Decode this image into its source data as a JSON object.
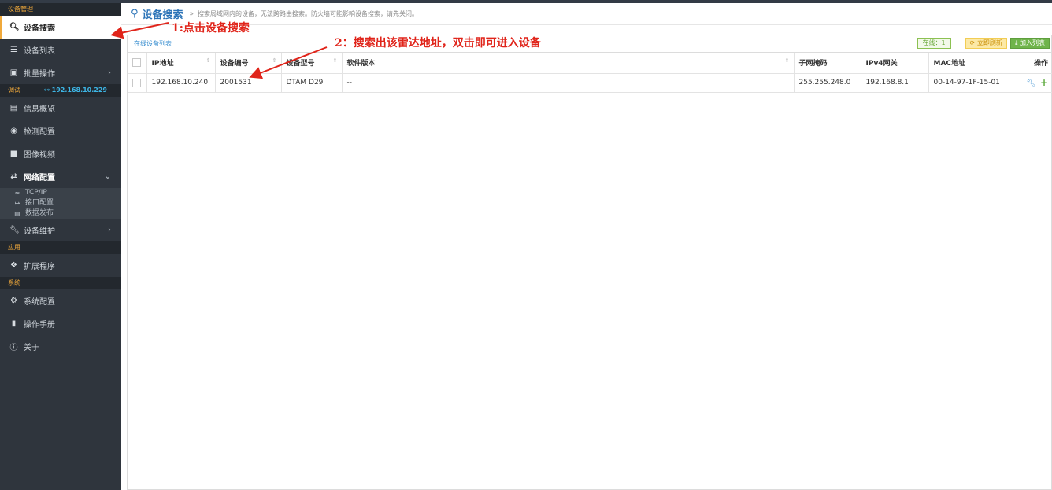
{
  "sidebar": {
    "sections": {
      "device_mgmt": "设备管理",
      "debug": "调试",
      "debug_ip": "192.168.10.229",
      "apps": "应用",
      "system": "系统"
    },
    "items": {
      "device_search": "设备搜索",
      "device_list": "设备列表",
      "batch_ops": "批量操作",
      "info_overview": "信息概览",
      "detect_config": "检测配置",
      "image_video": "图像视频",
      "network_config": "网络配置",
      "tcpip": "TCP/IP",
      "interface_config": "接口配置",
      "data_publish": "数据发布",
      "device_maint": "设备维护",
      "extensions": "扩展程序",
      "system_config": "系统配置",
      "manual": "操作手册",
      "about": "关于"
    }
  },
  "header": {
    "title": "设备搜索",
    "sep": "»",
    "desc": "搜索局域网内的设备，无法跨路由搜索。防火墙可能影响设备搜索，请先关闭。"
  },
  "panel": {
    "title": "在线设备列表",
    "online_badge": "在线：1",
    "refresh_label": "立即刷新",
    "add_label": "加入列表"
  },
  "table": {
    "headers": [
      "IP地址",
      "设备编号",
      "设备型号",
      "软件版本",
      "子网掩码",
      "IPv4网关",
      "MAC地址",
      "操作"
    ],
    "rows": [
      {
        "ip": "192.168.10.240",
        "device_no": "2001531",
        "model": "DTAM D29",
        "software": "--",
        "mask": "255.255.248.0",
        "gateway": "192.168.8.1",
        "mac": "00-14-97-1F-15-01"
      }
    ]
  },
  "annotations": {
    "step1": "1:点击设备搜索",
    "step2": "2：搜索出该雷达地址，双击即可进入设备"
  },
  "colors": {
    "sidebar_bg": "#2f353d",
    "section_text": "#f0a93b",
    "accent_blue": "#2b73b7",
    "annotation_red": "#e0241a"
  }
}
